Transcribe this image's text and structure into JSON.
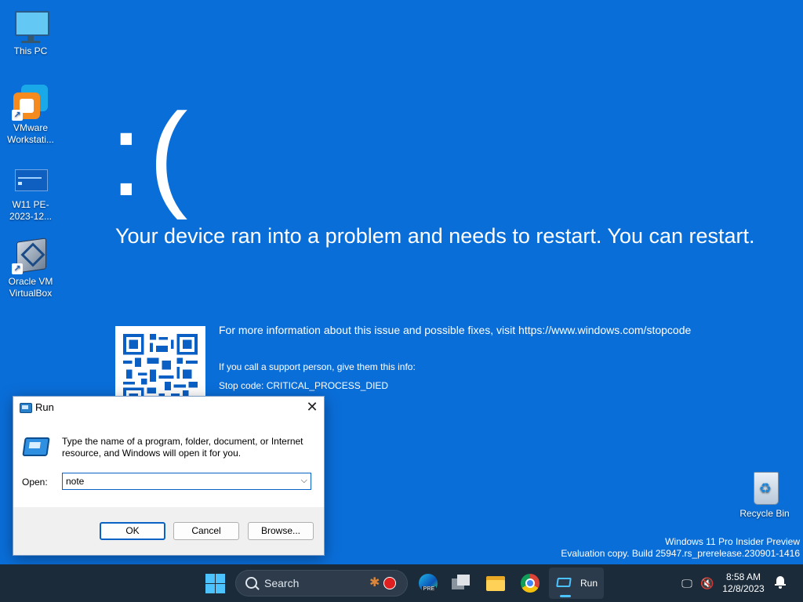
{
  "desktop": {
    "icons": [
      {
        "label": "This PC"
      },
      {
        "label": "VMware Workstati..."
      },
      {
        "label": "W11 PE-2023-12..."
      },
      {
        "label": "Oracle VM VirtualBox"
      },
      {
        "label": "Recycle Bin"
      }
    ],
    "background_color": "#0a6ed9"
  },
  "bsod": {
    "face": ":(",
    "message": "Your device ran into a problem and needs to restart. You can restart.",
    "more_info": "For more information about this issue and possible fixes, visit https://www.windows.com/stopcode",
    "support": "If you call a support person, give them this info:",
    "stop_code": "Stop code: CRITICAL_PROCESS_DIED"
  },
  "run_dialog": {
    "title": "Run",
    "description": "Type the name of a program, folder, document, or Internet resource, and Windows will open it for you.",
    "open_label": "Open:",
    "open_value": "note",
    "ok_label": "OK",
    "cancel_label": "Cancel",
    "browse_label": "Browse..."
  },
  "watermark": {
    "line1": "Windows 11 Pro Insider Preview",
    "line2": "Evaluation copy. Build 25947.rs_prerelease.230901-1416"
  },
  "taskbar": {
    "search_label": "Search",
    "edge_badge": "PRE",
    "run_label": "Run",
    "time": "8:58 AM",
    "date": "12/8/2023",
    "accent_color": "#4cc2ff"
  }
}
